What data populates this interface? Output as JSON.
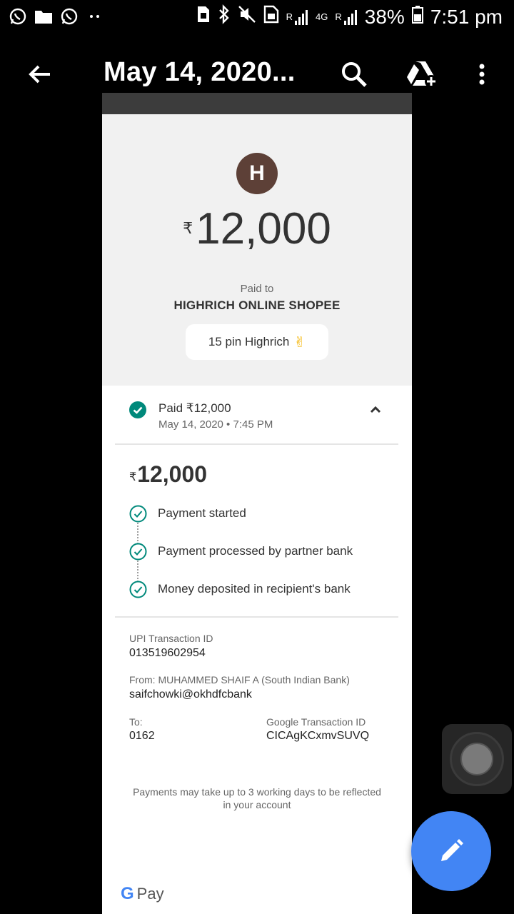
{
  "status_bar": {
    "network_left": "R",
    "network_type": "4G",
    "network_right": "R",
    "battery": "38%",
    "time": "7:51 pm"
  },
  "toolbar": {
    "title": "May 14, 2020..."
  },
  "payment": {
    "avatar_letter": "H",
    "currency_symbol": "₹",
    "amount": "12,000",
    "paid_to_label": "Paid to",
    "payee": "HIGHRICH ONLINE SHOPEE",
    "note": "15 pin Highrich",
    "note_emoji": "✌",
    "status_title": "Paid ₹12,000",
    "status_date": "May 14, 2020 • 7:45 PM",
    "detail_amount": "12,000",
    "steps": [
      "Payment started",
      "Payment processed by partner bank",
      "Money deposited in recipient's bank"
    ],
    "upi_label": "UPI Transaction ID",
    "upi_id": "013519602954",
    "from_label": "From: MUHAMMED SHAIF A (South Indian Bank)",
    "from_value": "saifchowki@okhdfcbank",
    "to_label": "To:",
    "to_value": "0162",
    "google_txn_label": "Google Transaction ID",
    "google_txn_id": "CICAgKCxmvSUVQ",
    "footnote": "Payments may take up to 3 working days to be reflected in your account",
    "brand": "Pay",
    "brand_g": "G"
  },
  "colors": {
    "success": "#00897b",
    "fab": "#4285f4",
    "avatar": "#5d4037"
  }
}
